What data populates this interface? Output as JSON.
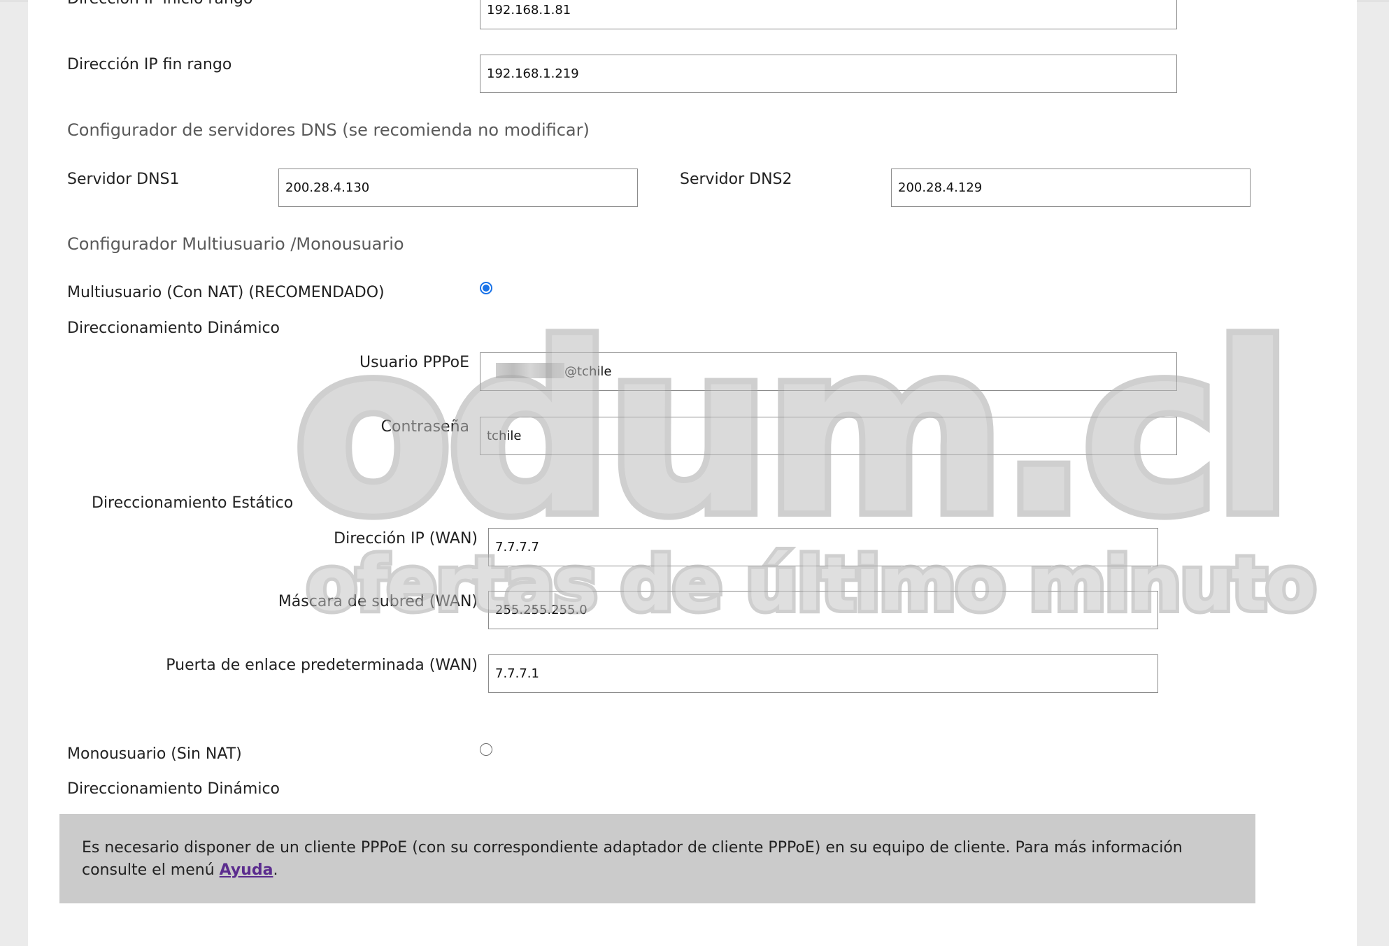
{
  "dhcp": {
    "start_label": "Dirección IP inicio rango",
    "start_value": "192.168.1.81",
    "end_label": "Dirección IP fin rango",
    "end_value": "192.168.1.219"
  },
  "dns": {
    "section_title": "Configurador de servidores DNS (se recomienda no modificar)",
    "dns1_label": "Servidor DNS1",
    "dns1_value": "200.28.4.130",
    "dns2_label": "Servidor DNS2",
    "dns2_value": "200.28.4.129"
  },
  "mode": {
    "section_title": "Configurador Multiusuario /Monousuario",
    "multi_label": "Multiusuario (Con NAT) (RECOMENDADO)",
    "multi_selected": true,
    "dynamic_label": "Direccionamiento Dinámico",
    "pppoe_user_label": "Usuario PPPoE",
    "pppoe_user_suffix": "@tchile",
    "password_label": "Contraseña",
    "password_value": "tchile",
    "static_label": "Direccionamiento Estático",
    "wan_ip_label": "Dirección IP (WAN)",
    "wan_ip_value": "7.7.7.7",
    "wan_mask_label": "Máscara de subred (WAN)",
    "wan_mask_value": "255.255.255.0",
    "wan_gw_label": "Puerta de enlace predeterminada (WAN)",
    "wan_gw_value": "7.7.7.1",
    "mono_label": "Monousuario (Sin NAT)",
    "mono_selected": false,
    "mono_dynamic_label": "Direccionamiento Dinámico"
  },
  "note": {
    "text": "Es necesario disponer de un cliente PPPoE (con su correspondiente adaptador de cliente PPPoE) en su equipo de cliente. Para más información consulte el menú",
    "link": "Ayuda",
    "end": "."
  },
  "watermark": {
    "brand": "odum.cl",
    "tagline": "ofertas de último minuto"
  },
  "colors": {
    "accent": "#1a73e8",
    "link": "#5b2c8e",
    "note_bg": "#cbcbcb"
  }
}
